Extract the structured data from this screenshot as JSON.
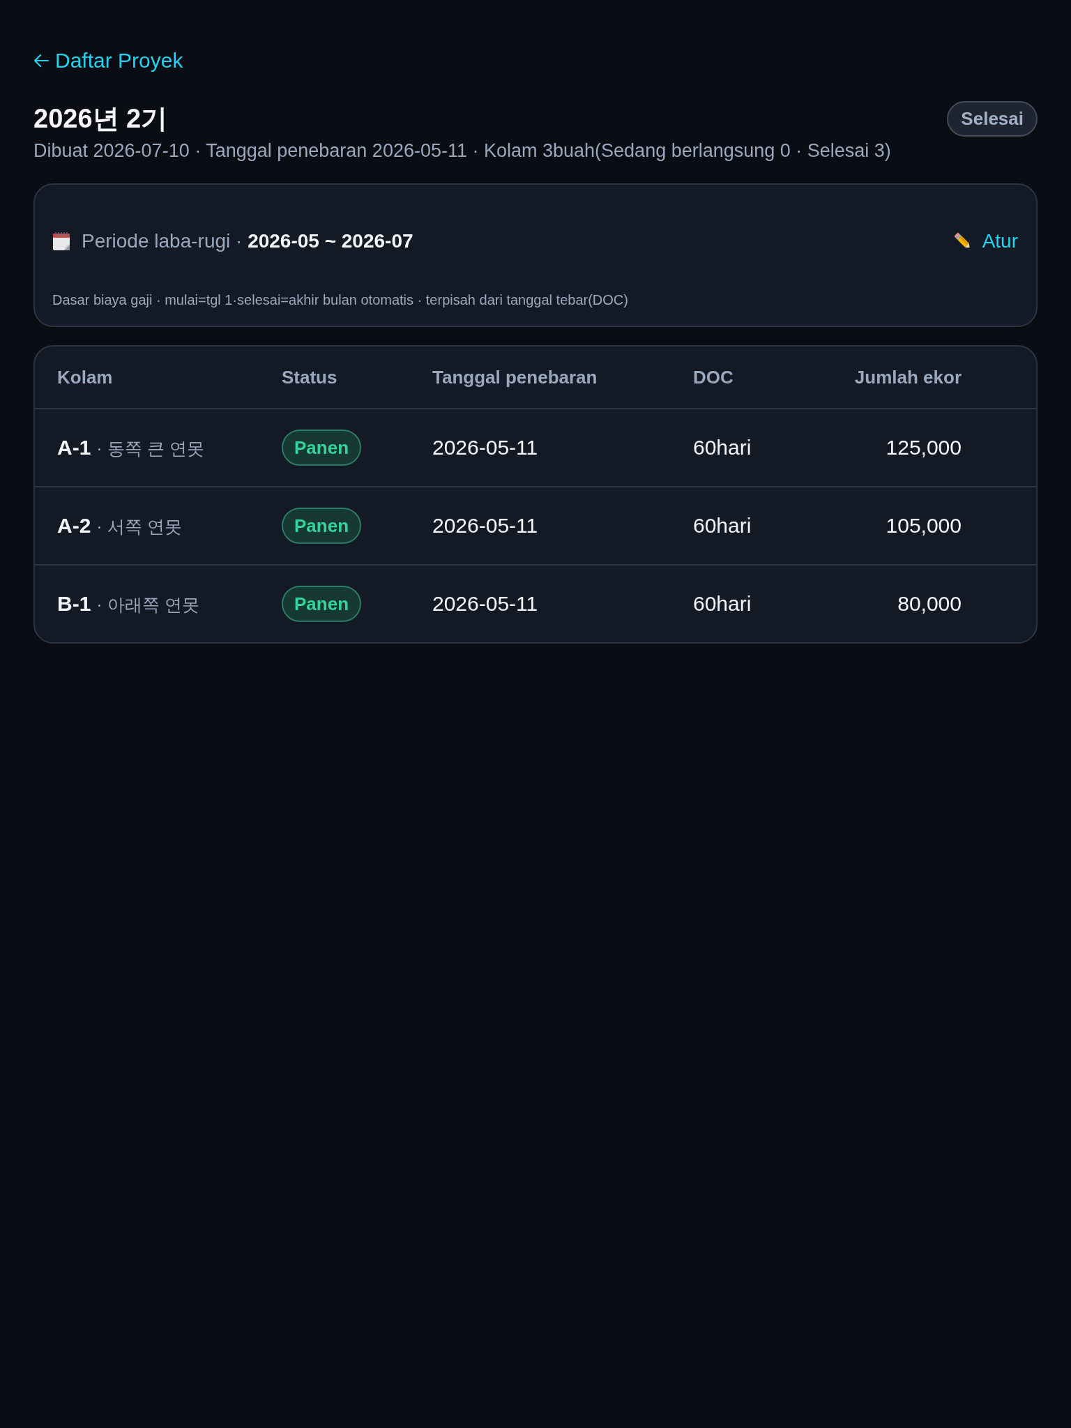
{
  "back_link": {
    "label": "Daftar Proyek"
  },
  "header": {
    "title": "2026년 2기",
    "status": "Selesai",
    "subtitle": "Dibuat 2026-07-10 · Tanggal penebaran 2026-05-11 · Kolam 3buah(Sedang berlangsung 0 · Selesai 3)"
  },
  "period_card": {
    "label": "Periode laba-rugi · **2026-05 ~ 2026-07**",
    "edit_button": "Atur",
    "note": "Dasar biaya gaji · mulai=tgl 1·selesai=akhir bulan otomatis · terpisah dari tanggal tebar(DOC)"
  },
  "table": {
    "columns": [
      {
        "label": "Kolam",
        "kind": "text"
      },
      {
        "label": "Status",
        "kind": "text"
      },
      {
        "label": "Tanggal penebaran",
        "kind": "text"
      },
      {
        "label": "DOC",
        "kind": "text"
      },
      {
        "label": "Jumlah ekor",
        "kind": "number"
      }
    ],
    "rows": [
      {
        "code": "A-1",
        "name": "· 동쪽 큰 연못",
        "status": "Panen",
        "stocking_date": "2026-05-11",
        "doc": "60hari",
        "count": "125,000"
      },
      {
        "code": "A-2",
        "name": "· 서쪽 연못",
        "status": "Panen",
        "stocking_date": "2026-05-11",
        "doc": "60hari",
        "count": "105,000"
      },
      {
        "code": "B-1",
        "name": "· 아래쪽 연못",
        "status": "Panen",
        "stocking_date": "2026-05-11",
        "doc": "60hari",
        "count": "80,000"
      }
    ]
  }
}
